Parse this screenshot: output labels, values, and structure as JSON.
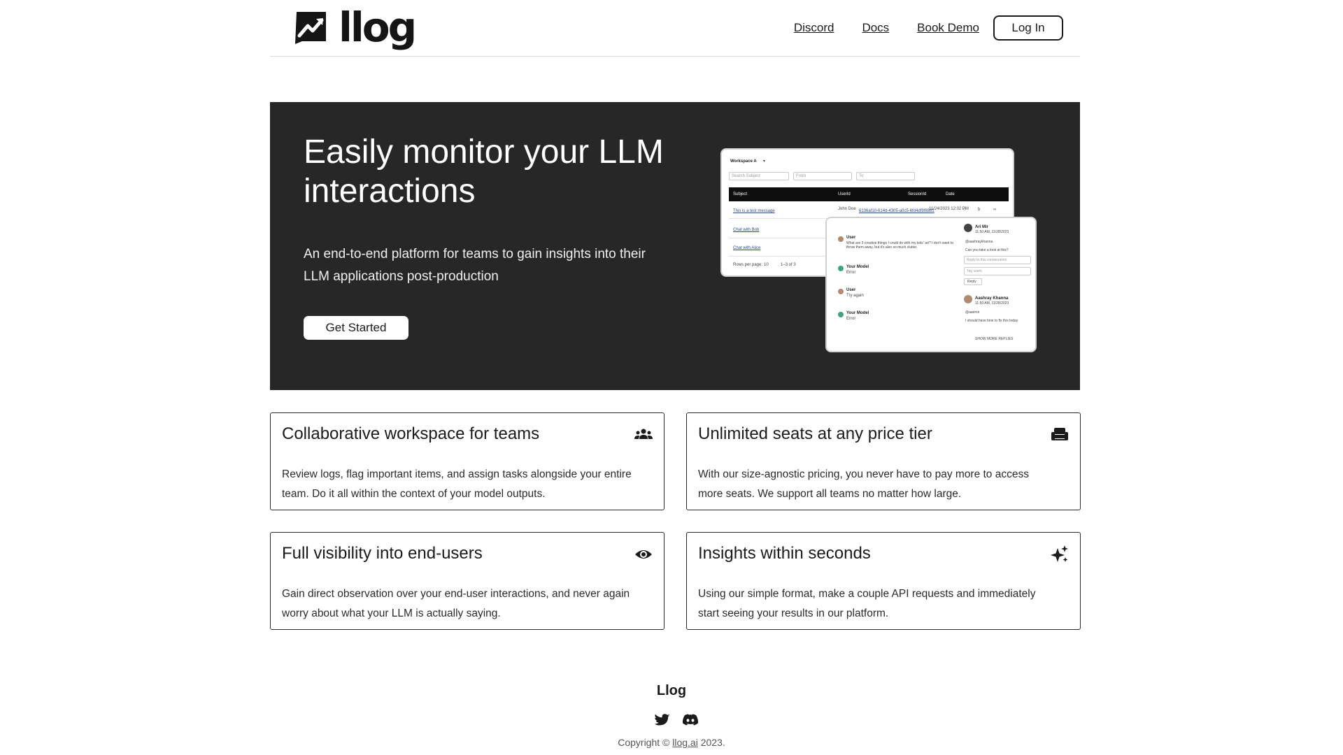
{
  "header": {
    "brand": "llog",
    "nav": {
      "discord": "Discord",
      "docs": "Docs",
      "book_demo": "Book Demo"
    },
    "login_label": "Log In"
  },
  "hero": {
    "title": "Easily monitor your LLM interactions",
    "subtitle": "An end-to-end platform for teams to gain insights into their LLM applications post-production",
    "cta_label": "Get Started",
    "mock": {
      "workspace": "Workspace A",
      "search_placeholder": "Search Subject",
      "from_placeholder": "From",
      "to_placeholder": "To",
      "columns": [
        "Subject",
        "UserId",
        "SessionId",
        "Date"
      ],
      "rows": [
        {
          "subject": "This is a test message",
          "user": "John Doe",
          "session": "6136af10-614d-4305-a0c5-6fd4df9f8881",
          "date": "11/24/2023 12:02 PM"
        },
        {
          "subject": "Chat with Bob",
          "user": "",
          "session": "",
          "date": ""
        },
        {
          "subject": "Chat with Alice",
          "user": "",
          "session": "",
          "date": ""
        }
      ],
      "pagination": {
        "rows_label": "Rows per page:",
        "rows_value": "10",
        "range": "1–3 of 3"
      },
      "conversation": [
        {
          "role": "User",
          "text": "What are 3 creative things I could do with my kids' art? I don't want to throw them away, but it's also so much clutter."
        },
        {
          "role": "Your Model",
          "text": "Error"
        },
        {
          "role": "User",
          "text": "Try again"
        },
        {
          "role": "Your Model",
          "text": "Error"
        }
      ],
      "comment": {
        "author": "Ari Mir",
        "time": "11:50 AM, 11/28/2023",
        "tag": "@aashraykhanna",
        "text": "Can you take a look at this?",
        "reply_placeholder": "Reply to this conversation",
        "tag_placeholder": "Tag users",
        "reply_label": "Reply"
      },
      "reply": {
        "author": "Aashray Khanna",
        "time": "11:50 AM, 11/28/2023",
        "tag": "@aarimir",
        "text": "I should have time to fix this today",
        "more_label": "SHOW MORE REPLIES"
      }
    }
  },
  "features": [
    {
      "title": "Collaborative workspace for teams",
      "description": "Review logs, flag important items, and assign tasks alongside your entire team. Do it all within the context of your model outputs.",
      "icon": "groups-icon"
    },
    {
      "title": "Unlimited seats at any price tier",
      "description": "With our size-agnostic pricing, you never have to pay more to access more seats. We support all teams no matter how large.",
      "icon": "chair-icon"
    },
    {
      "title": "Full visibility into end-users",
      "description": "Gain direct observation over your end-user interactions, and never again worry about what your LLM is actually saying.",
      "icon": "eye-icon"
    },
    {
      "title": "Insights within seconds",
      "description": "Using our simple format, make a couple API requests and immediately start seeing your results in our platform.",
      "icon": "sparkle-icon"
    }
  ],
  "footer": {
    "brand": "Llog",
    "social": [
      "twitter-icon",
      "discord-icon"
    ],
    "copyright_prefix": "Copyright ©",
    "copyright_link": "llog.ai",
    "copyright_suffix": "2023."
  },
  "colors": {
    "hero_bg": "#272727",
    "text": "#1a1a1a",
    "card_border": "#2a2a2a"
  }
}
